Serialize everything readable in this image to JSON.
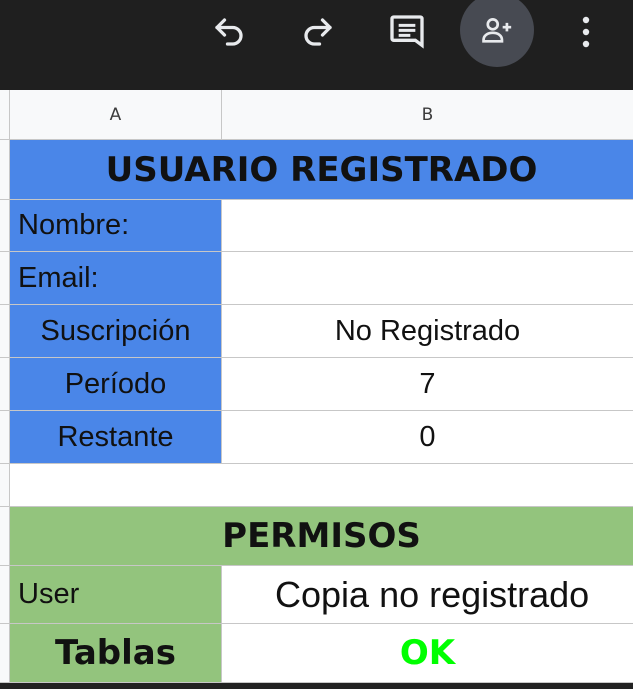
{
  "toolbar": {
    "icons": [
      "undo-icon",
      "redo-icon",
      "comment-icon",
      "add-person-icon",
      "more-vert-icon"
    ]
  },
  "columns": {
    "a": "A",
    "b": "B"
  },
  "usuario": {
    "title": "USUARIO REGISTRADO",
    "rows": [
      {
        "label": "Nombre:",
        "value": ""
      },
      {
        "label": "Email:",
        "value": ""
      },
      {
        "label": "Suscripción",
        "value": "No Registrado"
      },
      {
        "label": "Período",
        "value": "7"
      },
      {
        "label": "Restante",
        "value": "0"
      }
    ]
  },
  "permisos": {
    "title": "PERMISOS",
    "rows": [
      {
        "label": "User",
        "value": "Copia no registrado"
      },
      {
        "label": "Tablas",
        "value": "OK"
      }
    ]
  },
  "colors": {
    "header_blue": "#4a86e8",
    "header_green": "#93c47d",
    "ok_green": "#00ff00",
    "toolbar_bg": "#1f1f1f"
  }
}
